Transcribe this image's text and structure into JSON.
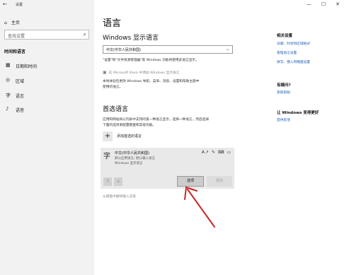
{
  "app": {
    "back_glyph": "←",
    "title": "设置"
  },
  "window_controls": [
    "—",
    "☐",
    "✕"
  ],
  "sidebar": {
    "home_label": "主页",
    "search_placeholder": "查找设置",
    "section_title": "时间和语言",
    "items": [
      {
        "icon": "calendar-icon",
        "glyph": "▦",
        "label": "日期和时间"
      },
      {
        "icon": "region-icon",
        "glyph": "◎",
        "label": "区域"
      },
      {
        "icon": "language-icon",
        "glyph": "字",
        "label": "语言"
      },
      {
        "icon": "microphone-icon",
        "glyph": "♪",
        "label": "语音"
      }
    ]
  },
  "main": {
    "title": "语言",
    "display_lang_heading": "Windows 显示语言",
    "display_lang_value": "中文(中华人民共和国)",
    "display_lang_desc": "\"设置\"和\"文件资源管理器\"等 Windows 功能将使用此语言显示。",
    "store_link": "在 Microsoft Store 中添加 Windows 显示语言",
    "store_desc_1": "本地体验包更改 Windows 导航、菜单、消息、设置和帮助主题中",
    "store_desc_2": "使用的语言。",
    "preferred_heading": "首选语言",
    "preferred_desc_1": "应用和网站将以列表中支持的第一种语言显示。选择一种语言，然后选择",
    "preferred_desc_2": "下面的选项来配置键盘和其他功能。",
    "add_lang_label": "添加首选的语言",
    "lang_card": {
      "name": "中文(中华人民共和国)",
      "sub1": "默认应用语言; 默认输入语言",
      "sub2": "Windows 显示语言",
      "features": "A↗ ✎ ⌨ ▭",
      "options_button": "选项",
      "remove_button": "删除"
    },
    "bottom_link": "从键盘中删除输入法等"
  },
  "right": {
    "related_heading": "相关设置",
    "related_links": [
      "日期、时间和区域格式",
      "管理语言设置",
      "拼写、键入和键盘设置"
    ],
    "question_heading": "有疑问?",
    "question_link": "获取帮助",
    "better_heading": "让 Windows 变得更好",
    "better_link": "提供反馈"
  }
}
